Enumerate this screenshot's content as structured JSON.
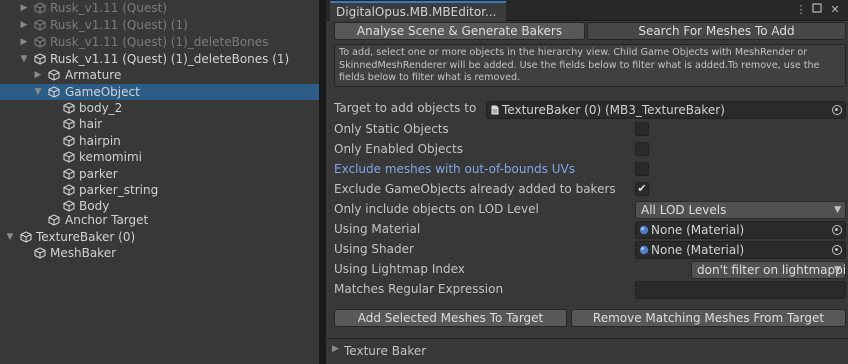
{
  "hierarchy": {
    "items": [
      {
        "label": "Rusk_v1.11 (Quest)",
        "arrow": "▶",
        "dim": true
      },
      {
        "label": "Rusk_v1.11 (Quest) (1)",
        "arrow": "▶",
        "dim": true
      },
      {
        "label": "Rusk_v1.11 (Quest) (1)_deleteBones",
        "arrow": "▶",
        "dim": true
      },
      {
        "label": "Rusk_v1.11 (Quest) (1)_deleteBones (1)",
        "arrow": "▼",
        "dim": false
      },
      {
        "label": "Armature",
        "arrow": "▶",
        "dim": false
      },
      {
        "label": "GameObject",
        "arrow": "▼",
        "dim": false,
        "selected": true
      },
      {
        "label": "body_2",
        "arrow": "",
        "dim": false
      },
      {
        "label": "hair",
        "arrow": "",
        "dim": false
      },
      {
        "label": "hairpin",
        "arrow": "",
        "dim": false
      },
      {
        "label": "kemomimi",
        "arrow": "",
        "dim": false
      },
      {
        "label": "parker",
        "arrow": "",
        "dim": false
      },
      {
        "label": "parker_string",
        "arrow": "",
        "dim": false
      },
      {
        "label": "Body",
        "arrow": "",
        "dim": false
      },
      {
        "label": "Anchor Target",
        "arrow": "",
        "dim": false
      },
      {
        "label": "TextureBaker (0)",
        "arrow": "▼",
        "dim": false
      },
      {
        "label": "MeshBaker",
        "arrow": "",
        "dim": false
      }
    ]
  },
  "window": {
    "tab_title": "DigitalOpus.MB.MBEditor...",
    "menu_icon": "kebab-menu-icon",
    "maximize_icon": "maximize-icon",
    "close_icon": "close-icon",
    "tabs": [
      "Analyse Scene & Generate Bakers",
      "Search For Meshes To Add"
    ],
    "help_text": "To add, select one or more objects in the hierarchy view. Child Game Objects with MeshRender or SkinnedMeshRenderer will be added. Use the fields below to filter what is added.To remove, use the fields below to filter what is removed.",
    "target_label": "Target to add objects to",
    "target_value": "TextureBaker (0) (MB3_TextureBaker)",
    "only_static_label": "Only Static Objects",
    "only_static_checked": false,
    "only_enabled_label": "Only Enabled Objects",
    "only_enabled_checked": false,
    "exclude_uv_label": "Exclude meshes with out-of-bounds UVs",
    "exclude_uv_checked": false,
    "exclude_added_label": "Exclude GameObjects already added to bakers",
    "exclude_added_checked": true,
    "check_glyph": "✔",
    "lod_label": "Only include objects on LOD Level",
    "lod_value": "All LOD Levels",
    "material_label": "Using Material",
    "material_value": "None (Material)",
    "shader_label": "Using Shader",
    "shader_value": "None (Material)",
    "lightmap_label": "Using Lightmap Index",
    "lightmap_value": "don't filter on lightmappi",
    "regex_label": "Matches Regular Expression",
    "regex_value": "",
    "add_button": "Add Selected Meshes To Target",
    "remove_button": "Remove Matching Meshes From Target",
    "footer_label": "Texture Baker",
    "caret": "▼",
    "footer_arrow": "▶"
  },
  "colors": {
    "selection": "#2c5d87",
    "link_text": "#80a8e6",
    "tab_accent": "#3a79bb",
    "panel_bg": "#383838"
  }
}
